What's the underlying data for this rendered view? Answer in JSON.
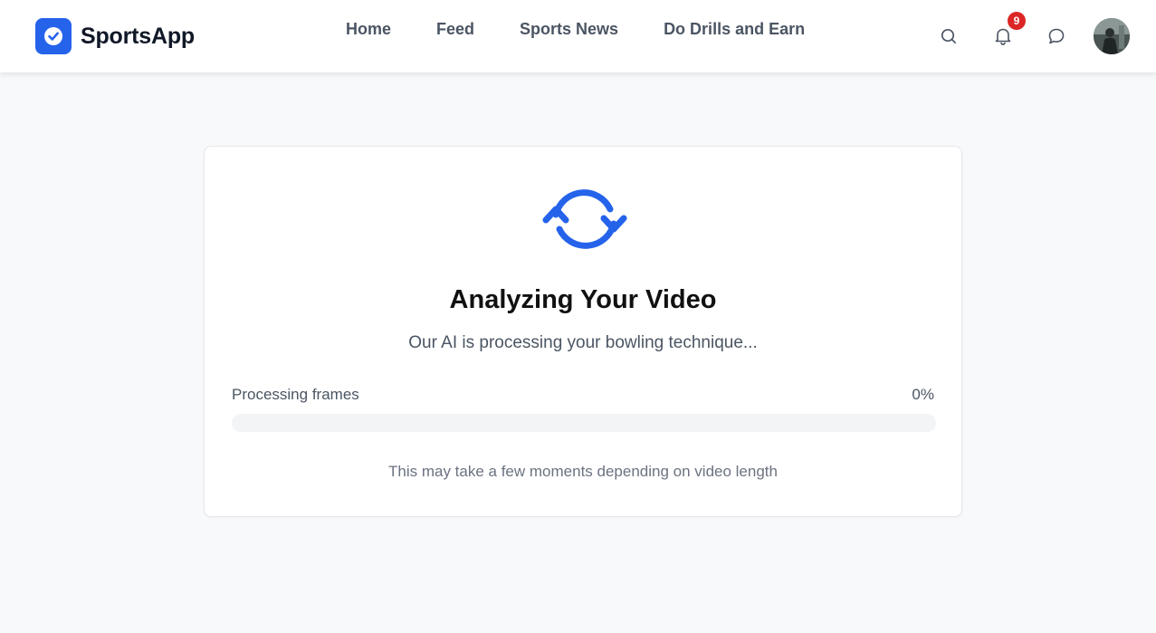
{
  "header": {
    "brand_name": "SportsApp",
    "brand_icon": "check-circle-icon",
    "nav": [
      {
        "label": "Home"
      },
      {
        "label": "Feed"
      },
      {
        "label": "Sports News"
      },
      {
        "label": "Do Drills and Earn"
      }
    ],
    "notification_count": "9",
    "icons": {
      "search": "search-icon",
      "notifications": "bell-icon",
      "messages": "chat-bubble-icon",
      "avatar": "user-avatar"
    }
  },
  "analysis": {
    "icon": "refresh-icon",
    "title": "Analyzing Your Video",
    "subtitle": "Our AI is processing your bowling technique...",
    "progress_label": "Processing frames",
    "progress_value_text": "0%",
    "progress_fraction": 0,
    "note": "This may take a few moments depending on video length"
  },
  "colors": {
    "accent": "#2563eb",
    "badge": "#dc2626",
    "background": "#f8f9fb"
  }
}
